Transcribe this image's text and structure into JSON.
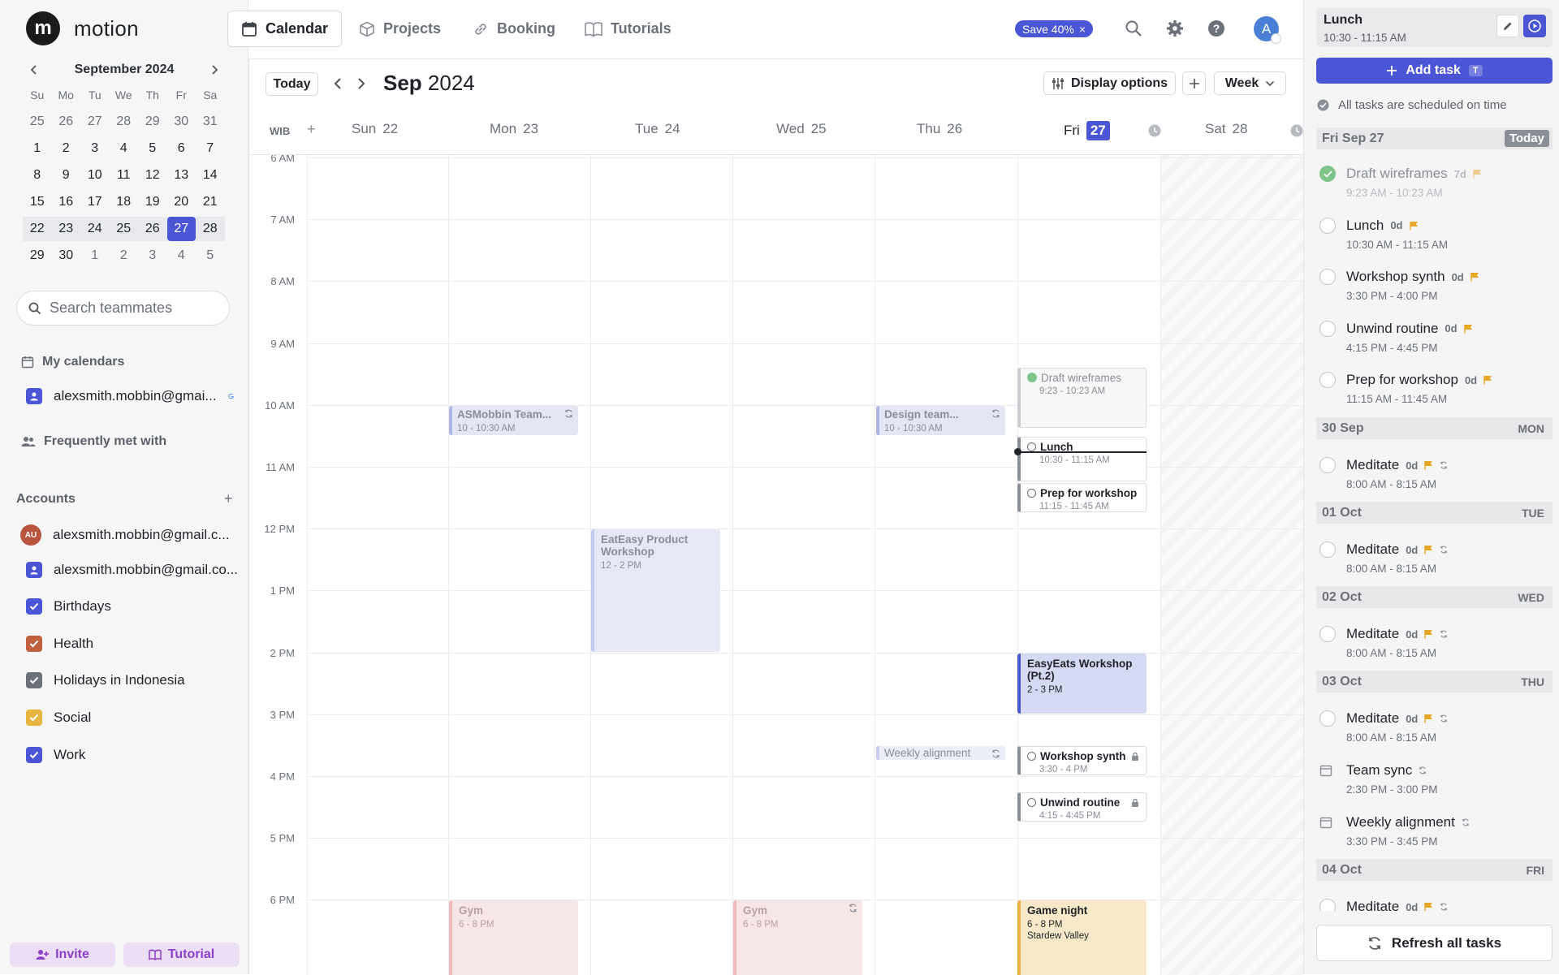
{
  "app": {
    "logo_glyph": "m",
    "name": "motion"
  },
  "nav": {
    "tabs": [
      {
        "label": "Calendar",
        "icon": "calendar-icon"
      },
      {
        "label": "Projects",
        "icon": "box-icon"
      },
      {
        "label": "Booking",
        "icon": "link-icon"
      },
      {
        "label": "Tutorials",
        "icon": "book-icon"
      }
    ],
    "promo": "Save 40%",
    "promo_close": "×",
    "avatar": "A"
  },
  "mini_cal": {
    "title": "September 2024",
    "weekdays": [
      "Su",
      "Mo",
      "Tu",
      "We",
      "Th",
      "Fr",
      "Sa"
    ],
    "weeks": [
      [
        "25",
        "26",
        "27",
        "28",
        "29",
        "30",
        "31"
      ],
      [
        "1",
        "2",
        "3",
        "4",
        "5",
        "6",
        "7"
      ],
      [
        "8",
        "9",
        "10",
        "11",
        "12",
        "13",
        "14"
      ],
      [
        "15",
        "16",
        "17",
        "18",
        "19",
        "20",
        "21"
      ],
      [
        "22",
        "23",
        "24",
        "25",
        "26",
        "27",
        "28"
      ],
      [
        "29",
        "30",
        "1",
        "2",
        "3",
        "4",
        "5"
      ]
    ],
    "selected": "27"
  },
  "sidebar": {
    "search_placeholder": "Search teammates",
    "my_calendars_label": "My calendars",
    "my_calendar_email": "alexsmith.mobbin@gmai...",
    "frequently_met_label": "Frequently met with",
    "accounts_label": "Accounts",
    "accounts_add": "+",
    "account_badge": "AU",
    "account_1": "alexsmith.mobbin@gmail.c...",
    "account_2": "alexsmith.mobbin@gmail.co...",
    "calendars": [
      {
        "label": "Birthdays",
        "color": "#4a56d6"
      },
      {
        "label": "Health",
        "color": "#c0603e"
      },
      {
        "label": "Holidays in Indonesia",
        "color": "#6b7079"
      },
      {
        "label": "Social",
        "color": "#e7b440"
      },
      {
        "label": "Work",
        "color": "#4a56d6"
      }
    ],
    "invite": "Invite",
    "tutorial": "Tutorial"
  },
  "calendar": {
    "today_btn": "Today",
    "month_bold": "Sep",
    "year": "2024",
    "display_options": "Display options",
    "view": "Week",
    "tz": "WIB",
    "days": [
      {
        "name": "Sun",
        "num": "22"
      },
      {
        "name": "Mon",
        "num": "23"
      },
      {
        "name": "Tue",
        "num": "24"
      },
      {
        "name": "Wed",
        "num": "25"
      },
      {
        "name": "Thu",
        "num": "26"
      },
      {
        "name": "Fri",
        "num": "27"
      },
      {
        "name": "Sat",
        "num": "28"
      }
    ],
    "hours": [
      "6 AM",
      "7 AM",
      "8 AM",
      "9 AM",
      "10 AM",
      "11 AM",
      "12 PM",
      "1 PM",
      "2 PM",
      "3 PM",
      "4 PM",
      "5 PM",
      "6 PM"
    ],
    "events": {
      "asmobbin": {
        "title": "ASMobbin Team...",
        "time": "10 - 10:30 AM"
      },
      "design": {
        "title": "Design team...",
        "time": "10 - 10:30 AM"
      },
      "eateasy": {
        "title": "EatEasy Product Workshop",
        "time": "12 - 2 PM"
      },
      "easyeats": {
        "title": "EasyEats Workshop (Pt.2)",
        "time": "2 - 3 PM"
      },
      "weekly": {
        "title": "Weekly alignment"
      },
      "gym_mon": {
        "title": "Gym",
        "time": "6 - 8 PM"
      },
      "gym_wed": {
        "title": "Gym",
        "time": "6 - 8 PM"
      },
      "game": {
        "title": "Game night",
        "time": "6 - 8 PM",
        "location": "Stardew Valley"
      }
    },
    "tasks": {
      "draft": {
        "title": "Draft wireframes",
        "time": "9:23 - 10:23 AM"
      },
      "lunch": {
        "title": "Lunch",
        "time": "10:30 - 11:15 AM"
      },
      "prep": {
        "title": "Prep for workshop",
        "time": "11:15 - 11:45 AM"
      },
      "synth": {
        "title": "Workshop synth",
        "time": "3:30 - 4 PM"
      },
      "unwind": {
        "title": "Unwind routine",
        "time": "4:15 - 4:45 PM"
      }
    }
  },
  "right": {
    "current_task": {
      "title": "Lunch",
      "time": "10:30 - 11:15 AM"
    },
    "add_task": "Add task",
    "add_task_shortcut": "T",
    "status": "All tasks are scheduled on time",
    "today_header": {
      "date": "Fri Sep 27",
      "tag": "Today"
    },
    "today_tasks": [
      {
        "title": "Draft wireframes",
        "meta": "7d",
        "time": "9:23 AM - 10:23 AM",
        "done": true
      },
      {
        "title": "Lunch",
        "meta": "0d",
        "time": "10:30 AM - 11:15 AM"
      },
      {
        "title": "Workshop synth",
        "meta": "0d",
        "time": "3:30 PM - 4:00 PM"
      },
      {
        "title": "Unwind routine",
        "meta": "0d",
        "time": "4:15 PM - 4:45 PM"
      },
      {
        "title": "Prep for workshop",
        "meta": "0d",
        "time": "11:15 AM - 11:45 AM"
      }
    ],
    "day_30": {
      "date": "30 Sep",
      "dow": "MON"
    },
    "day_01": {
      "date": "01 Oct",
      "dow": "TUE"
    },
    "day_02": {
      "date": "02 Oct",
      "dow": "WED"
    },
    "day_03": {
      "date": "03 Oct",
      "dow": "THU"
    },
    "day_04": {
      "date": "04 Oct",
      "dow": "FRI"
    },
    "meditate": {
      "title": "Meditate",
      "meta": "0d",
      "time": "8:00 AM - 8:15 AM"
    },
    "team_sync": {
      "title": "Team sync",
      "time": "2:30 PM - 3:00 PM"
    },
    "weekly_alignment": {
      "title": "Weekly alignment",
      "time": "3:30 PM - 3:45 PM"
    },
    "refresh": "Refresh all tasks"
  }
}
